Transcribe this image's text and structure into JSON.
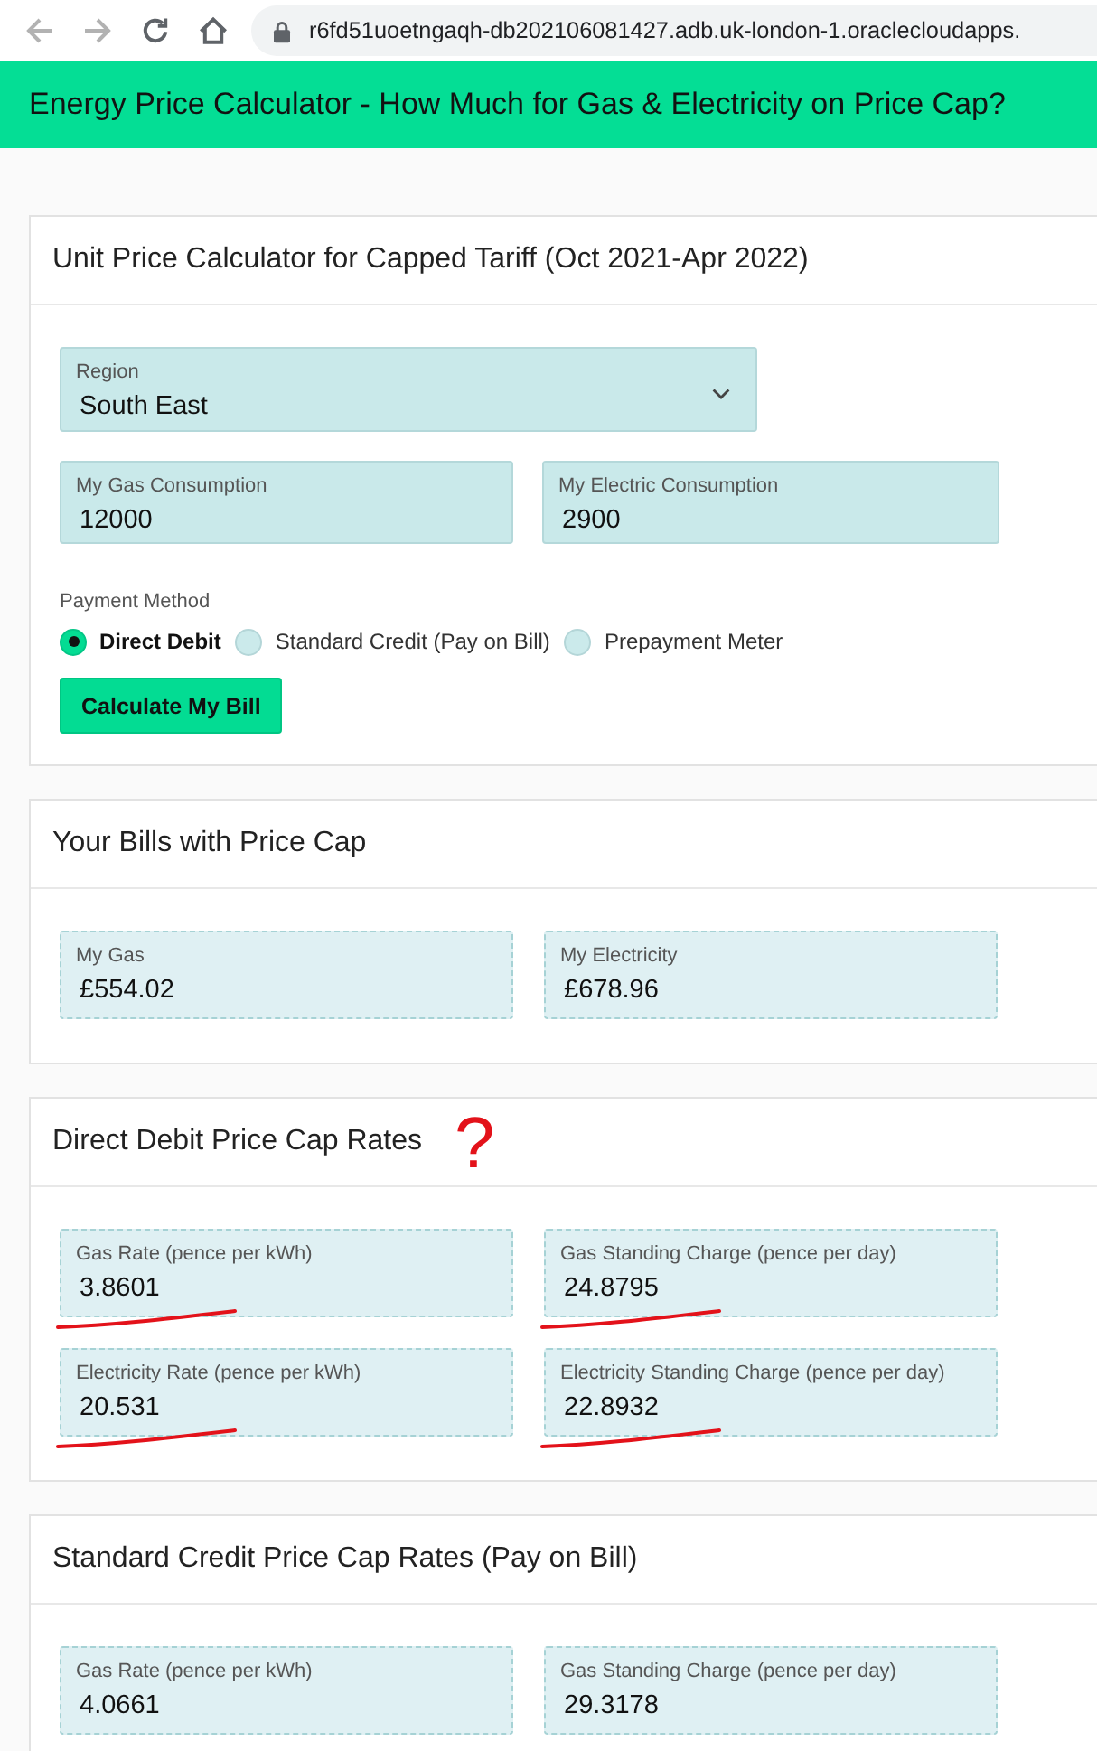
{
  "browser": {
    "nav": [
      {
        "kind": "back",
        "disabled": true
      },
      {
        "kind": "forward",
        "disabled": true
      },
      {
        "kind": "reload",
        "disabled": false
      },
      {
        "kind": "home",
        "disabled": false
      }
    ],
    "url": "r6fd51uoetngaqh-db202106081427.adb.uk-london-1.oraclecloudapps."
  },
  "header": {
    "title": "Energy Price Calculator - How Much for Gas & Electricity on Price Cap?"
  },
  "cards": [
    {
      "kind": "form",
      "title": "Unit Price Calculator for Capped Tariff (Oct 2021-Apr 2022)",
      "region": {
        "label": "Region",
        "value": "South East"
      },
      "inputs": [
        {
          "label": "My Gas Consumption",
          "value": "12000"
        },
        {
          "label": "My Electric Consumption",
          "value": "2900"
        }
      ],
      "payment": {
        "label": "Payment Method",
        "options": [
          {
            "label": "Direct Debit",
            "selected": true
          },
          {
            "label": "Standard Credit (Pay on Bill)",
            "selected": false
          },
          {
            "label": "Prepayment Meter",
            "selected": false
          }
        ]
      },
      "button": "Calculate My Bill"
    },
    {
      "kind": "outputs",
      "title": "Your Bills with Price Cap",
      "fields": [
        {
          "label": "My Gas",
          "value": "£554.02",
          "underlined": false
        },
        {
          "label": "My Electricity",
          "value": "£678.96",
          "underlined": false
        }
      ]
    },
    {
      "kind": "outputs",
      "title": "Direct Debit Price Cap Rates",
      "annotation": "?",
      "fields": [
        {
          "label": "Gas Rate (pence per kWh)",
          "value": "3.8601",
          "underlined": true
        },
        {
          "label": "Gas Standing Charge (pence per day)",
          "value": "24.8795",
          "underlined": true
        },
        {
          "label": "Electricity Rate (pence per kWh)",
          "value": "20.531",
          "underlined": true
        },
        {
          "label": "Electricity Standing Charge (pence per day)",
          "value": "22.8932",
          "underlined": true
        }
      ]
    },
    {
      "kind": "outputs",
      "title": "Standard Credit Price Cap Rates (Pay on Bill)",
      "fields": [
        {
          "label": "Gas Rate (pence per kWh)",
          "value": "4.0661",
          "underlined": false
        },
        {
          "label": "Gas Standing Charge (pence per day)",
          "value": "29.3178",
          "underlined": false
        }
      ]
    }
  ]
}
